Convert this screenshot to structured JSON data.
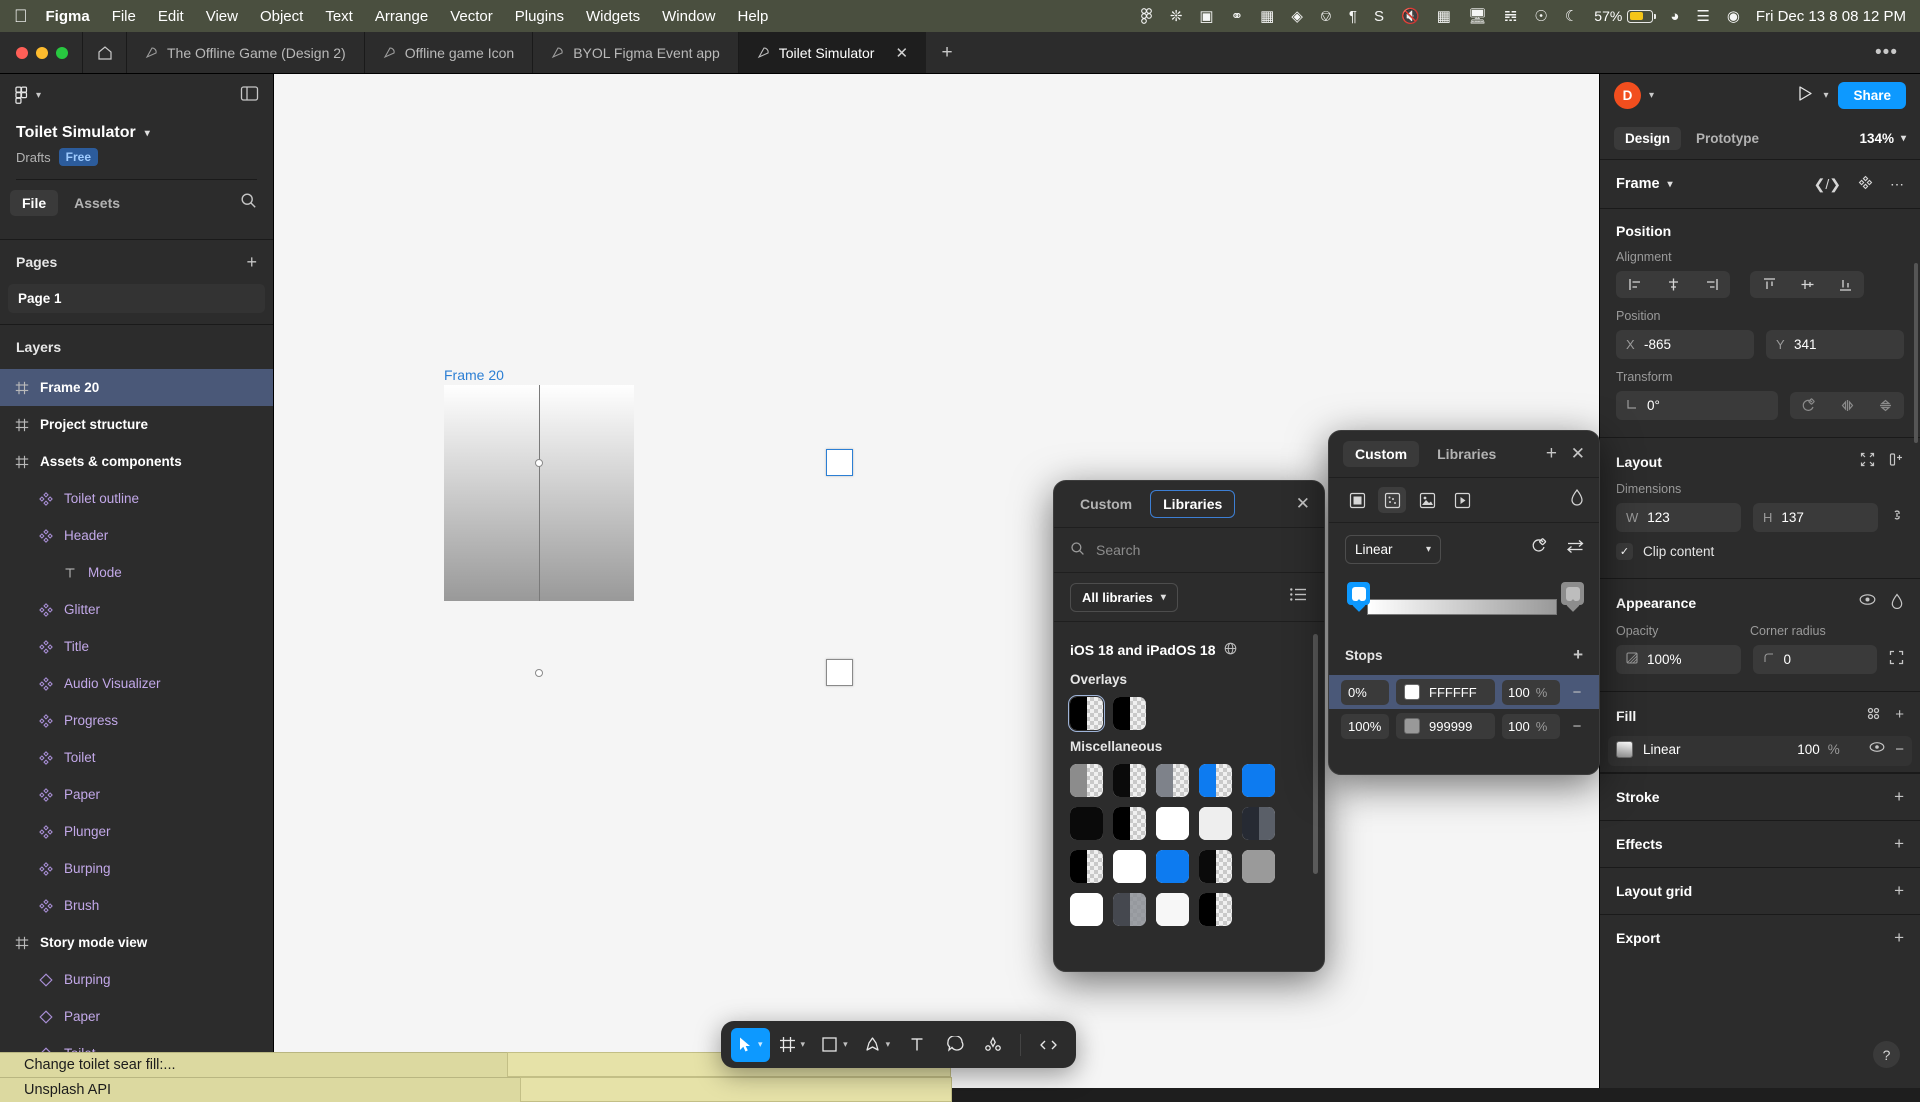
{
  "macbar": {
    "apple_icon": "apple-icon",
    "items": [
      {
        "label": "Figma",
        "bold": true
      },
      {
        "label": "File",
        "bold": false
      },
      {
        "label": "Edit",
        "bold": false
      },
      {
        "label": "View",
        "bold": false
      },
      {
        "label": "Object",
        "bold": false
      },
      {
        "label": "Text",
        "bold": false
      },
      {
        "label": "Arrange",
        "bold": false
      },
      {
        "label": "Vector",
        "bold": false
      },
      {
        "label": "Plugins",
        "bold": false
      },
      {
        "label": "Widgets",
        "bold": false
      },
      {
        "label": "Window",
        "bold": false
      },
      {
        "label": "Help",
        "bold": false
      }
    ],
    "status_icons": [
      "figma-menu-icon",
      "openai-icon",
      "display-tile-icon",
      "record-icon",
      "photo-icon",
      "vpn-icon",
      "coffee-icon",
      "paragraph-icon",
      "stripe-icon",
      "volume-mute-icon",
      "grid-icon",
      "screen-icon",
      "bluetooth-icon",
      "account-icon",
      "moon-icon"
    ],
    "battery_percent": "57%",
    "wifi_icon": "wifi-icon",
    "control_center_icon": "control-center-icon",
    "siri_icon": "siri-icon",
    "clock": "Fri Dec 13  8 08 12 PM"
  },
  "tabbar": {
    "home_icon": "home-icon",
    "tabs": [
      {
        "label": "The Offline Game (Design 2)",
        "active": false
      },
      {
        "label": "Offline game Icon",
        "active": false
      },
      {
        "label": "BYOL Figma Event app",
        "active": false
      },
      {
        "label": "Toilet Simulator",
        "active": true
      }
    ],
    "new_tab_label": "+",
    "overflow_label": "•••"
  },
  "left_panel": {
    "file_name": "Toilet Simulator",
    "location": "Drafts",
    "plan_badge": "Free",
    "tabs": [
      {
        "label": "File",
        "active": true
      },
      {
        "label": "Assets",
        "active": false
      }
    ],
    "search_icon": "search-icon",
    "pages_header": "Pages",
    "pages_add": "+",
    "pages": [
      {
        "label": "Page 1",
        "active": true
      }
    ],
    "layers_header": "Layers",
    "layers": [
      {
        "label": "Frame 20",
        "type": "frame",
        "indent": 0,
        "selected": true
      },
      {
        "label": "Project structure",
        "type": "frame",
        "indent": 0,
        "selected": false
      },
      {
        "label": "Assets & components",
        "type": "frame",
        "indent": 0,
        "selected": false
      },
      {
        "label": "Toilet outline",
        "type": "comp",
        "indent": 1,
        "selected": false
      },
      {
        "label": "Header",
        "type": "comp",
        "indent": 1,
        "selected": false
      },
      {
        "label": "Mode",
        "type": "text",
        "indent": 2,
        "selected": false
      },
      {
        "label": "Glitter",
        "type": "comp",
        "indent": 1,
        "selected": false
      },
      {
        "label": "Title",
        "type": "comp",
        "indent": 1,
        "selected": false
      },
      {
        "label": "Audio Visualizer",
        "type": "comp",
        "indent": 1,
        "selected": false
      },
      {
        "label": "Progress",
        "type": "comp",
        "indent": 1,
        "selected": false
      },
      {
        "label": "Toilet",
        "type": "comp",
        "indent": 1,
        "selected": false
      },
      {
        "label": "Paper",
        "type": "comp",
        "indent": 1,
        "selected": false
      },
      {
        "label": "Plunger",
        "type": "comp",
        "indent": 1,
        "selected": false
      },
      {
        "label": "Burping",
        "type": "comp",
        "indent": 1,
        "selected": false
      },
      {
        "label": "Brush",
        "type": "comp",
        "indent": 1,
        "selected": false
      },
      {
        "label": "Story mode view",
        "type": "frame",
        "indent": 0,
        "selected": false
      },
      {
        "label": "Burping",
        "type": "inst",
        "indent": 1,
        "selected": false
      },
      {
        "label": "Paper",
        "type": "inst",
        "indent": 1,
        "selected": false
      },
      {
        "label": "Toilet",
        "type": "inst",
        "indent": 1,
        "selected": false
      }
    ]
  },
  "autocomplete": [
    {
      "text": "Change toilet sear fill:..."
    },
    {
      "text": "Unsplash API"
    }
  ],
  "canvas": {
    "frame_label": "Frame 20"
  },
  "libraries_popup": {
    "tabs": [
      {
        "label": "Custom",
        "active": false
      },
      {
        "label": "Libraries",
        "active": true
      }
    ],
    "close_icon": "close-icon",
    "search_icon": "search-icon",
    "search_placeholder": "Search",
    "search_value": "",
    "filter_label": "All libraries",
    "list_view_icon": "list-view-icon",
    "library_name": "iOS 18 and iPadOS 18",
    "library_globe_icon": "globe-icon",
    "groups": [
      {
        "name": "Overlays",
        "swatches": [
          {
            "color": "#000000",
            "style": "half",
            "selected": true
          },
          {
            "color": "#000000",
            "style": "half",
            "selected": false
          }
        ]
      },
      {
        "name": "Miscellaneous",
        "swatches": [
          {
            "color": "#8c8c8c",
            "style": "half",
            "selected": false
          },
          {
            "color": "#0a0a0a",
            "style": "half",
            "selected": false
          },
          {
            "color": "#7e828a",
            "style": "half",
            "selected": false
          },
          {
            "color": "#0d7bf0",
            "style": "half",
            "selected": false
          },
          {
            "color": "#0d7bf0",
            "style": "full",
            "selected": false
          },
          {
            "color": "#0a0a0a",
            "style": "full",
            "selected": false
          },
          {
            "color": "#000000",
            "style": "half",
            "selected": false
          },
          {
            "color": "#ffffff",
            "style": "full",
            "selected": false
          },
          {
            "color": "#eeeeee",
            "style": "full",
            "selected": false
          },
          {
            "color": "#262a33",
            "style": "halfdark",
            "selected": false
          },
          {
            "color": "#000000",
            "style": "half",
            "selected": false
          },
          {
            "color": "#ffffff",
            "style": "full",
            "selected": false
          },
          {
            "color": "#0d7bf0",
            "style": "full",
            "selected": false
          },
          {
            "color": "#0a0a0a",
            "style": "half",
            "selected": false
          },
          {
            "color": "#9a9a9a",
            "style": "full",
            "selected": false
          },
          {
            "color": "#ffffff",
            "style": "full",
            "selected": false
          },
          {
            "color": "#45484f",
            "style": "halfgrey",
            "selected": false
          },
          {
            "color": "#f7f7f7",
            "style": "full",
            "selected": false
          },
          {
            "color": "#000000",
            "style": "half",
            "selected": false
          }
        ]
      }
    ]
  },
  "gradient_popup": {
    "tabs": [
      {
        "label": "Custom",
        "active": true
      },
      {
        "label": "Libraries",
        "active": false
      }
    ],
    "add_icon": "plus-icon",
    "close_icon": "close-icon",
    "paint_type_icons": [
      "solid-fill-icon",
      "gradient-fill-icon",
      "image-fill-icon",
      "video-fill-icon"
    ],
    "eyedropper_icon": "eyedropper-icon",
    "gradient_type": "Linear",
    "rotate_icon": "rotate-icon",
    "flip_icon": "flip-icon",
    "stops_header": "Stops",
    "stops_add": "+",
    "stops": [
      {
        "position": "0%",
        "hex": "FFFFFF",
        "opacity": "100",
        "unit": "%",
        "swatch": "#ffffff",
        "selected": true
      },
      {
        "position": "100%",
        "hex": "999999",
        "opacity": "100",
        "unit": "%",
        "swatch": "#999999",
        "selected": false
      }
    ]
  },
  "right_panel": {
    "avatar_initial": "D",
    "present_icon": "play-icon",
    "share_label": "Share",
    "tabs": [
      {
        "label": "Design",
        "active": true
      },
      {
        "label": "Prototype",
        "active": false
      }
    ],
    "zoom_level": "134%",
    "node_type": "Frame",
    "node_actions": [
      "code-icon",
      "component-icon",
      "more-icon"
    ],
    "position": {
      "title": "Position",
      "alignment_label": "Alignment",
      "align_icons": [
        "align-left-icon",
        "align-horizontal-center-icon",
        "align-right-icon",
        "align-top-icon",
        "align-vertical-center-icon",
        "align-bottom-icon"
      ],
      "position_label": "Position",
      "x_key": "X",
      "x_value": "-865",
      "y_key": "Y",
      "y_value": "341",
      "transform_label": "Transform",
      "rotation_value": "0°",
      "rotation_icon": "angle-icon",
      "corner_tool_icons": [
        "corner-radius-tool-icon",
        "flip-horizontal-icon",
        "flip-vertical-icon"
      ]
    },
    "layout": {
      "title": "Layout",
      "header_icons": [
        "autolayout-collapse-icon",
        "add-autolayout-icon"
      ],
      "dimensions_label": "Dimensions",
      "w_key": "W",
      "w_value": "123",
      "h_key": "H",
      "h_value": "137",
      "lock_ratio_icon": "link-icon",
      "clip_content_label": "Clip content",
      "clip_content_checked": true
    },
    "appearance": {
      "title": "Appearance",
      "header_icons": [
        "visibility-icon",
        "blend-mode-icon"
      ],
      "opacity_label": "Opacity",
      "opacity_value": "100%",
      "opacity_icon": "opacity-icon",
      "corner_radius_label": "Corner radius",
      "corner_radius_value": "0",
      "corner_radius_icon": "corner-icon",
      "independent_corners_icon": "independent-corners-icon"
    },
    "fill": {
      "title": "Fill",
      "header_icons": [
        "styles-icon",
        "plus-icon"
      ],
      "items": [
        {
          "name": "Linear",
          "opacity": "100",
          "unit": "%",
          "visibility_icon": "eye-icon",
          "remove_icon": "minus-icon"
        }
      ]
    },
    "sections": [
      {
        "title": "Stroke",
        "action": "+"
      },
      {
        "title": "Effects",
        "action": "+"
      },
      {
        "title": "Layout grid",
        "action": "+"
      },
      {
        "title": "Export",
        "action": "+"
      }
    ],
    "help_label": "?"
  },
  "toolbar": {
    "tools": [
      {
        "name": "move-tool",
        "glyph": "cursor",
        "active": true,
        "caret": true
      },
      {
        "name": "frame-tool",
        "glyph": "frame",
        "active": false,
        "caret": true
      },
      {
        "name": "shape-tool",
        "glyph": "square",
        "active": false,
        "caret": true
      },
      {
        "name": "pen-tool",
        "glyph": "pen",
        "active": false,
        "caret": true
      },
      {
        "name": "text-tool",
        "glyph": "text",
        "active": false,
        "caret": false
      },
      {
        "name": "comment-tool",
        "glyph": "comment",
        "active": false,
        "caret": false
      },
      {
        "name": "actions-tool",
        "glyph": "actions",
        "active": false,
        "caret": false
      },
      {
        "name": "dev-mode-tool",
        "glyph": "code",
        "active": false,
        "caret": false
      }
    ]
  },
  "colors": {
    "accent": "#0d99ff",
    "selection": "#4a5878",
    "avatar": "#f24e1e",
    "menubar": "#4a4f3f",
    "panel": "#2c2c2c",
    "canvas": "#f5f5f5",
    "component_text": "#c2a8e8",
    "autocomplete": "#dcd9a0"
  }
}
